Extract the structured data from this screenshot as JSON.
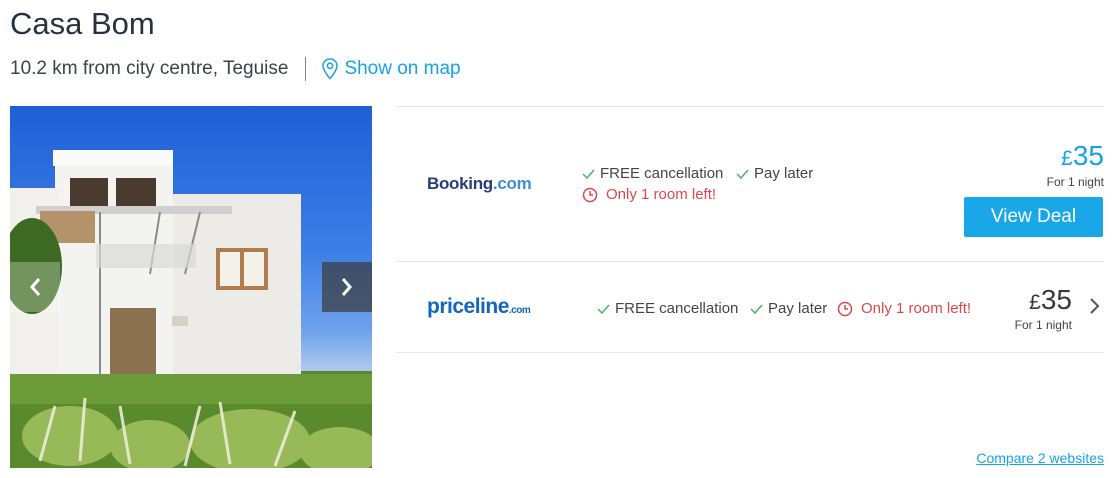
{
  "hotel": {
    "name": "Casa Bom",
    "location": "10.2 km from city centre, Teguise",
    "map_link": "Show on map"
  },
  "photo": {
    "prev_icon": "chevron-left-icon",
    "next_icon": "chevron-right-icon"
  },
  "deals": [
    {
      "provider": "Booking.com",
      "logo_main": "Booking",
      "logo_dot": ".com",
      "features": [
        "FREE cancellation",
        "Pay later"
      ],
      "warning": "Only 1 room left!",
      "currency": "£",
      "price": "35",
      "per": "For 1 night",
      "button": "View Deal"
    },
    {
      "provider": "priceline.com",
      "logo_main": "priceline",
      "logo_dot": ".com",
      "features": [
        "FREE cancellation",
        "Pay later"
      ],
      "warning": "Only 1 room left!",
      "currency": "£",
      "price": "35",
      "per": "For 1 night"
    }
  ],
  "compare_link": "Compare 2 websites",
  "colors": {
    "accent": "#16a3e6",
    "button": "#1aa7e8",
    "warning": "#e0464e",
    "check": "#4caf6a",
    "title": "#26323d"
  },
  "icons": {
    "map": "map-pin-icon",
    "check": "check-icon",
    "clock": "clock-icon",
    "chevron": "chevron-right-icon"
  }
}
